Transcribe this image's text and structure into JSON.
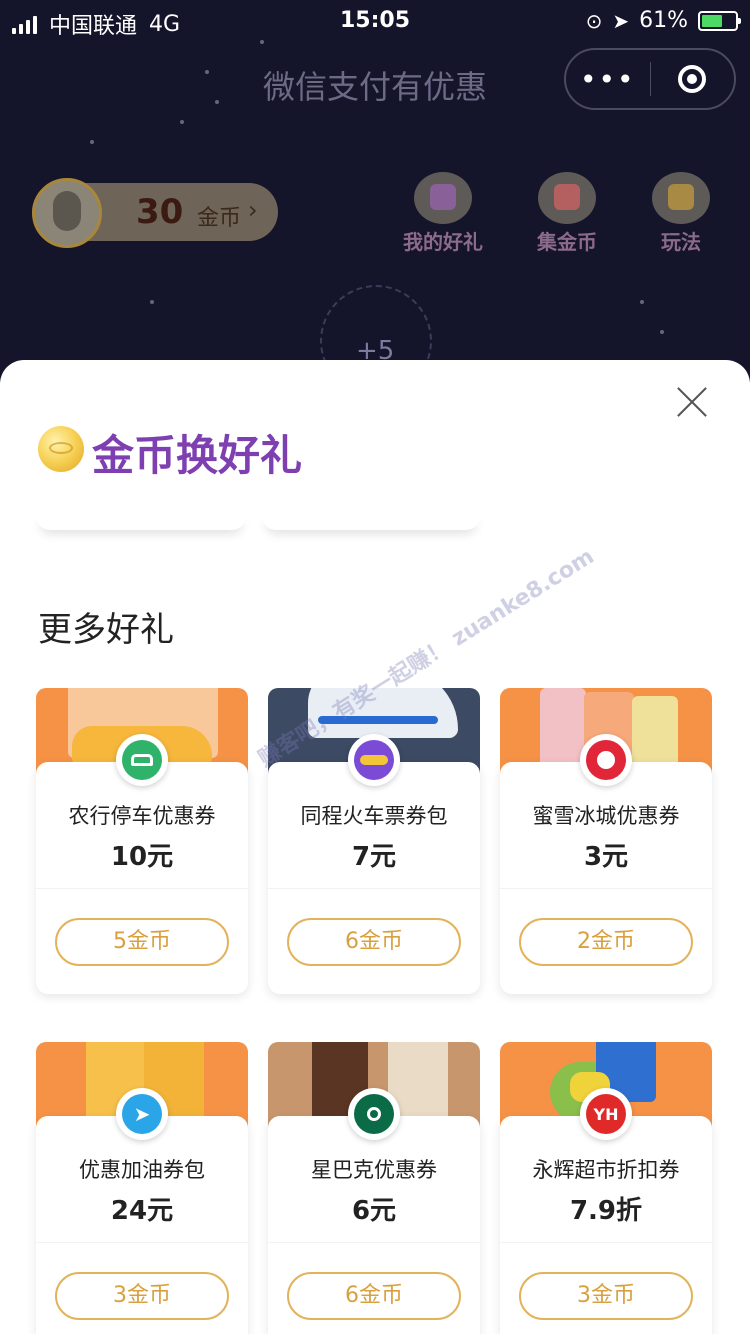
{
  "status_bar": {
    "carrier": "中国联通",
    "network": "4G",
    "time": "15:05",
    "battery": "61%",
    "battery_level": 0.61
  },
  "nav": {
    "title": "微信支付有优惠",
    "more_label": "•••"
  },
  "profile": {
    "coin_count": "30",
    "coin_unit": "金币",
    "arrow": "›"
  },
  "top_actions": [
    {
      "label": "我的好礼",
      "icon": "gift-icon"
    },
    {
      "label": "集金币",
      "icon": "task-list-icon"
    },
    {
      "label": "玩法",
      "icon": "rules-icon"
    }
  ],
  "center": {
    "bonus": "+5"
  },
  "sheet": {
    "title": "金币换好礼",
    "section_title": "更多好礼"
  },
  "watermark": "赚客吧，有奖一起赚！ zuanke8.com",
  "gifts": [
    {
      "name": "农行停车优惠券",
      "value": "10元",
      "cost": "5金币",
      "logo": "car-icon",
      "logo_color": "#2fb36a"
    },
    {
      "name": "同程火车票券包",
      "value": "7元",
      "cost": "6金币",
      "logo": "airship-icon",
      "logo_color": "#7b4bd6"
    },
    {
      "name": "蜜雪冰城优惠券",
      "value": "3元",
      "cost": "2金币",
      "logo": "snowman-icon",
      "logo_color": "#e2263a"
    },
    {
      "name": "优惠加油券包",
      "value": "24元",
      "cost": "3金币",
      "logo": "navigation-icon",
      "logo_color": "#2aa6e8"
    },
    {
      "name": "星巴克优惠券",
      "value": "6元",
      "cost": "6金币",
      "logo": "starbucks-icon",
      "logo_color": "#0b6b46"
    },
    {
      "name": "永辉超市折扣券",
      "value": "7.9折",
      "cost": "3金币",
      "logo": "yh-icon",
      "logo_color": "#e02a2a",
      "logo_text": "YH"
    }
  ],
  "colors": {
    "accent_gold": "#e2b35a",
    "title_purple": "#7e3fb0",
    "banner_orange": "#f69246"
  }
}
